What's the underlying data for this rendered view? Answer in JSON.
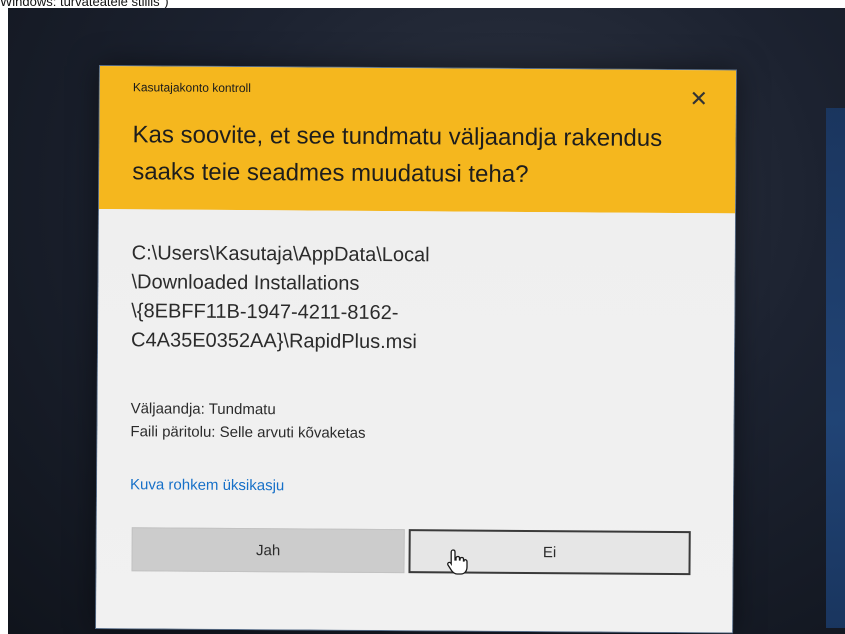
{
  "caption": "Windows: turvateatele stiilis\")",
  "dialog": {
    "title": "Kasutajakonto kontroll",
    "close_symbol": "✕",
    "headline": "Kas soovite, et see tundmatu väljaandja rakendus saaks teie seadmes muudatusi teha?",
    "program_path_lines": [
      "C:\\Users\\Kasutaja\\AppData\\Local",
      "\\Downloaded Installations",
      "\\{8EBFF11B-1947-4211-8162-",
      "C4A35E0352AA}\\RapidPlus.msi"
    ],
    "publisher": "Väljaandja: Tundmatu",
    "file_origin": "Faili päritolu: Selle arvuti kõvaketas",
    "details_link": "Kuva rohkem üksikasju",
    "yes_button": "Jah",
    "no_button": "Ei"
  },
  "icons": {
    "close": "close-icon",
    "cursor": "hand-pointer-icon"
  },
  "colors": {
    "header": "#f5b71e",
    "body": "#f2f2f2",
    "link": "#1670c8"
  }
}
